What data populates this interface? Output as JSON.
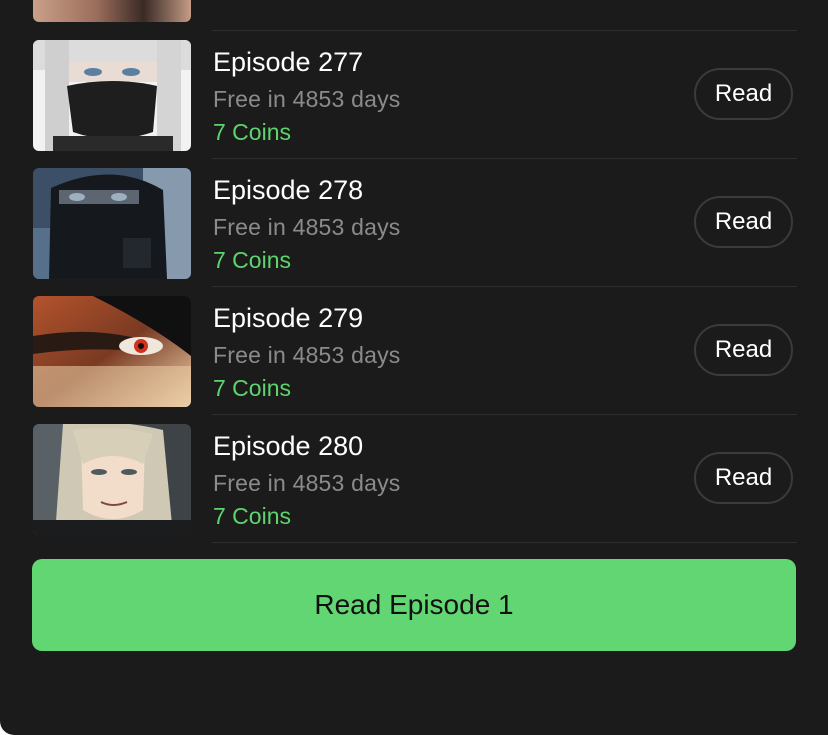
{
  "episodes": [
    {
      "title": "Episode 277",
      "free": "Free in 4853 days",
      "coins": "7 Coins",
      "button": "Read",
      "thumb_icon": "episode-277-cover"
    },
    {
      "title": "Episode 278",
      "free": "Free in 4853 days",
      "coins": "7 Coins",
      "button": "Read",
      "thumb_icon": "episode-278-cover"
    },
    {
      "title": "Episode 279",
      "free": "Free in 4853 days",
      "coins": "7 Coins",
      "button": "Read",
      "thumb_icon": "episode-279-cover"
    },
    {
      "title": "Episode 280",
      "free": "Free in 4853 days",
      "coins": "7 Coins",
      "button": "Read",
      "thumb_icon": "episode-280-cover"
    }
  ],
  "cta": {
    "label": "Read Episode 1"
  },
  "colors": {
    "background": "#1b1b1b",
    "accent_green": "#62d672",
    "coins_green": "#5fd46c",
    "muted_text": "#8b8b8b"
  }
}
